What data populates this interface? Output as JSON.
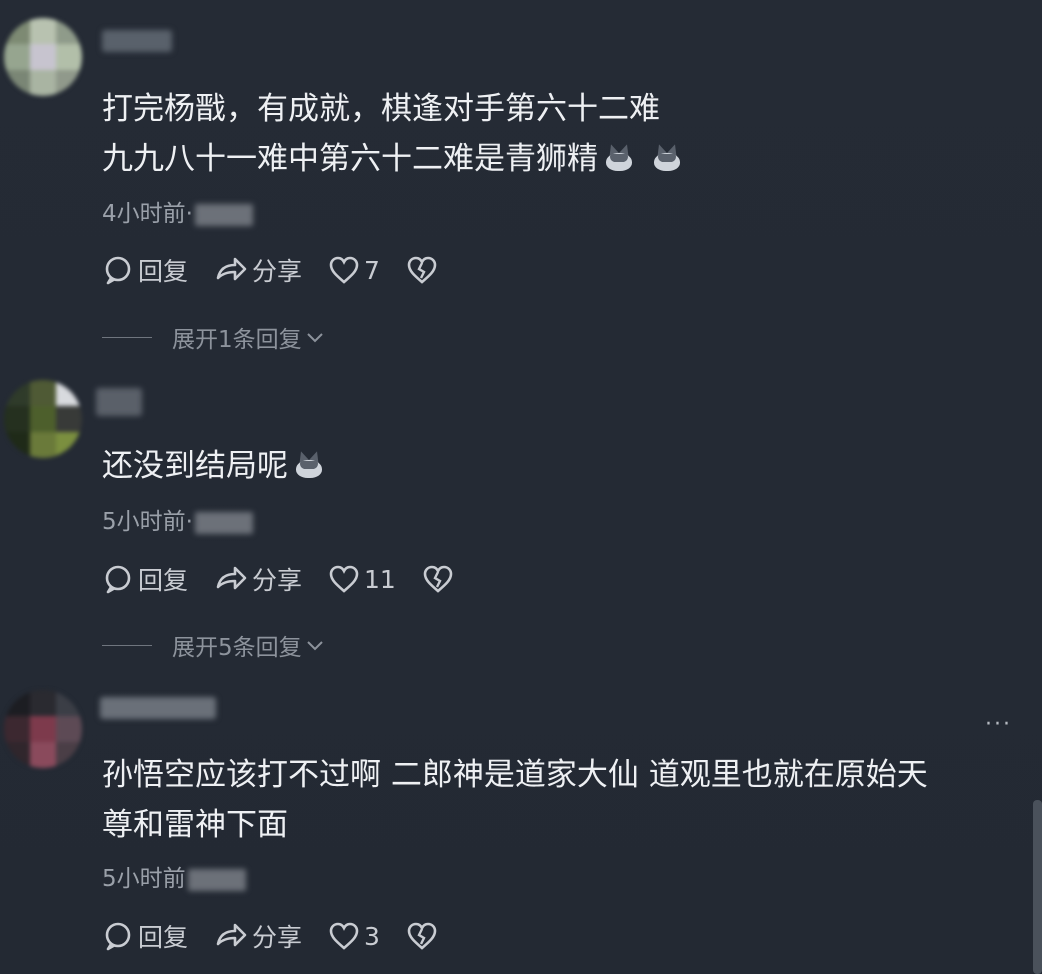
{
  "comments": [
    {
      "text_lines": [
        "打完杨戬，有成就，棋逢对手第六十二难",
        "九九八十一难中第六十二难是青狮精"
      ],
      "emoji_count": 2,
      "time": "4小时前·",
      "actions": {
        "reply": "回复",
        "share": "分享",
        "likes": "7"
      },
      "expand": "展开1条回复"
    },
    {
      "text_lines": [
        "还没到结局呢"
      ],
      "emoji_count": 1,
      "time": "5小时前·",
      "actions": {
        "reply": "回复",
        "share": "分享",
        "likes": "11"
      },
      "expand": "展开5条回复"
    },
    {
      "text_lines": [
        "孙悟空应该打不过啊 二郎神是道家大仙 道观里也就在原始天",
        "尊和雷神下面"
      ],
      "emoji_count": 0,
      "time": "5小时前",
      "actions": {
        "reply": "回复",
        "share": "分享",
        "likes": "3"
      },
      "more": "···"
    }
  ],
  "emoji_name": "wolf-emoji",
  "colors": {
    "background": "#242a34",
    "text": "#eef0f3",
    "meta": "#9aa0a9",
    "action": "#c9ccd2"
  }
}
